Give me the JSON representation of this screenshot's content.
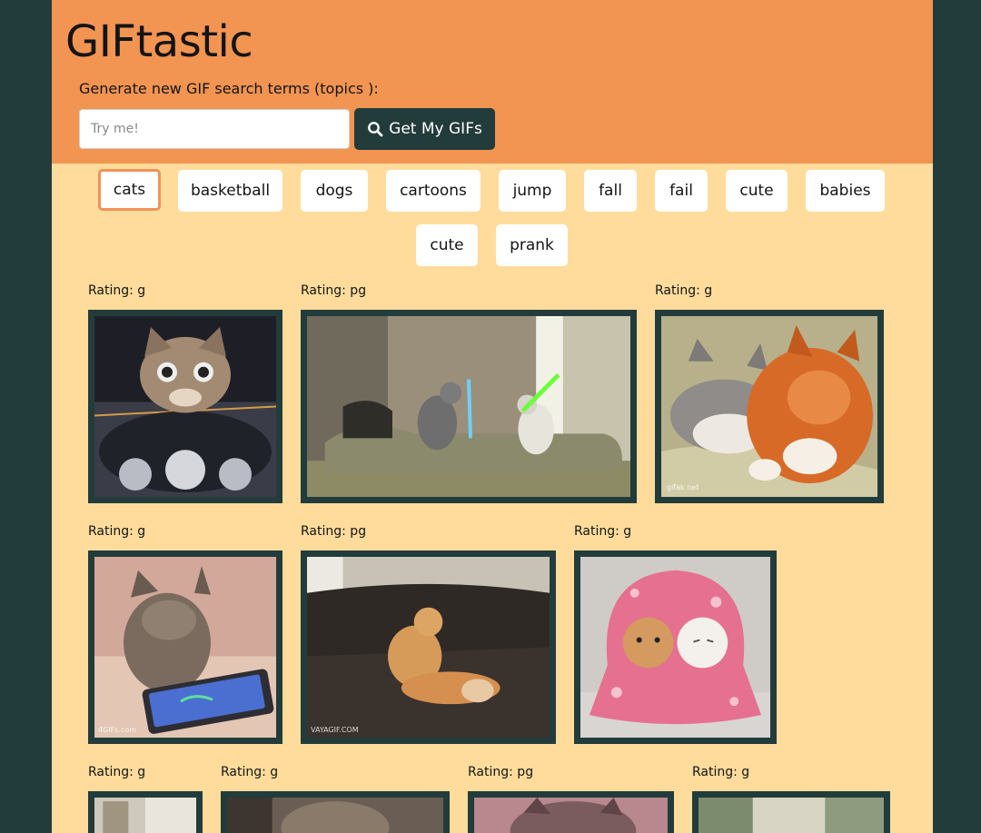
{
  "header": {
    "title": "GIFtastic",
    "prompt": "Generate new GIF search terms (topics ):",
    "search": {
      "placeholder": "Try me!",
      "value": ""
    },
    "button_label": "Get My GIFs"
  },
  "topics": [
    "cats",
    "basketball",
    "dogs",
    "cartoons",
    "jump",
    "fall",
    "fail",
    "cute",
    "babies",
    "cute",
    "prank"
  ],
  "active_topic": "cats",
  "gifs": [
    {
      "rating": "Rating: g"
    },
    {
      "rating": "Rating: pg"
    },
    {
      "rating": "Rating: g",
      "watermark": "gifak.net"
    },
    {
      "rating": "Rating: g",
      "watermark": "4GIFs.com"
    },
    {
      "rating": "Rating: pg",
      "watermark": "VAYAGIF.COM"
    },
    {
      "rating": "Rating: g"
    },
    {
      "rating": "Rating: g"
    },
    {
      "rating": "Rating: g"
    },
    {
      "rating": "Rating: pg"
    },
    {
      "rating": "Rating: g"
    }
  ],
  "colors": {
    "background": "#223c3b",
    "header": "#f29452",
    "content": "#ffdc9c",
    "button": "#223c3b",
    "active_outline": "#f0925a"
  }
}
